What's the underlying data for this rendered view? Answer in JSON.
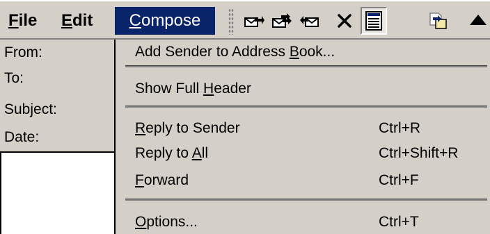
{
  "menubar": {
    "file": {
      "pre": "",
      "key": "F",
      "post": "ile"
    },
    "edit": {
      "pre": "",
      "key": "E",
      "post": "dit"
    },
    "compose": {
      "pre": "",
      "key": "C",
      "post": "ompose"
    }
  },
  "toolbar": {
    "icons": [
      "reply-icon",
      "reply-all-icon",
      "forward-icon",
      "delete-icon",
      "show-header-icon",
      "move-icon",
      "previous-icon"
    ]
  },
  "header_pane": {
    "from": "From:",
    "to": "To:",
    "subject": "Subject:",
    "date": "Date:"
  },
  "compose_menu": {
    "add_sender": {
      "pre": "Add Sender to Address ",
      "key": "B",
      "post": "ook..."
    },
    "show_full_header": {
      "pre": "Show Full ",
      "key": "H",
      "post": "eader"
    },
    "reply_to_sender": {
      "pre": "",
      "key": "R",
      "post": "eply to Sender",
      "accel": "Ctrl+R"
    },
    "reply_to_all": {
      "pre": "Reply to ",
      "key": "A",
      "post": "ll",
      "accel": "Ctrl+Shift+R"
    },
    "forward": {
      "pre": "",
      "key": "F",
      "post": "orward",
      "accel": "Ctrl+F"
    },
    "options": {
      "pre": "",
      "key": "O",
      "post": "ptions...",
      "accel": "Ctrl+T"
    }
  },
  "colors": {
    "face": "#d4d0c8",
    "highlight": "#0a246a"
  }
}
